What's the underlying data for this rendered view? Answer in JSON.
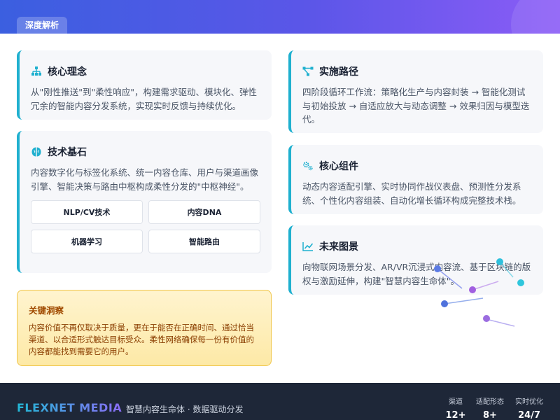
{
  "header": {
    "tag": "深度解析"
  },
  "cards": {
    "core_concept": {
      "title": "核心理念",
      "body": "从\"刚性推送\"到\"柔性响应\"，构建需求驱动、模块化、弹性冗余的智能内容分发系统，实现实时反馈与持续优化。"
    },
    "tech_foundation": {
      "title": "技术基石",
      "body": "内容数字化与标签化系统、统一内容仓库、用户与渠道画像引擎、智能决策与路由中枢构成柔性分发的\"中枢神经\"。",
      "chips": [
        "NLP/CV技术",
        "内容DNA",
        "机器学习",
        "智能路由"
      ]
    },
    "implementation": {
      "title": "实施路径",
      "body": "四阶段循环工作流：策略化生产与内容封装 → 智能化测试与初始投放 → 自适应放大与动态调整 → 效果归因与模型迭代。"
    },
    "core_components": {
      "title": "核心组件",
      "body": "动态内容适配引擎、实时协同作战仪表盘、预测性分发系统、个性化内容组装、自动化增长循环构成完整技术栈。"
    },
    "future": {
      "title": "未来图景",
      "body": "向物联网场景分发、AR/VR沉浸式内容流、基于区块链的版权与激励延伸，构建\"智慧内容生命体\"。"
    }
  },
  "insight": {
    "title": "关键洞察",
    "body": "内容价值不再仅取决于质量，更在于能否在正确时间、通过恰当渠道、以合适形式触达目标受众。柔性网络确保每一份有价值的内容都能找到需要它的用户。"
  },
  "footer": {
    "brand": "FLEXNET MEDIA",
    "tagline": "智慧内容生命体 · 数据驱动分发",
    "stats": [
      {
        "label": "渠道",
        "value": "12+"
      },
      {
        "label": "适配形态",
        "value": "8+"
      },
      {
        "label": "实时优化",
        "value": "24/7"
      }
    ]
  },
  "colors": {
    "accent_cyan": "#1fb0cf",
    "header_blue": "#3b5fe0",
    "header_purple": "#8b5cf6",
    "insight_text": "#8a3d00",
    "footer_bg": "#1e2738"
  },
  "icons": {
    "core_concept": "sitemap-icon",
    "tech_foundation": "brain-icon",
    "implementation": "project-diagram-icon",
    "core_components": "cogs-icon",
    "future": "line-chart-icon"
  }
}
